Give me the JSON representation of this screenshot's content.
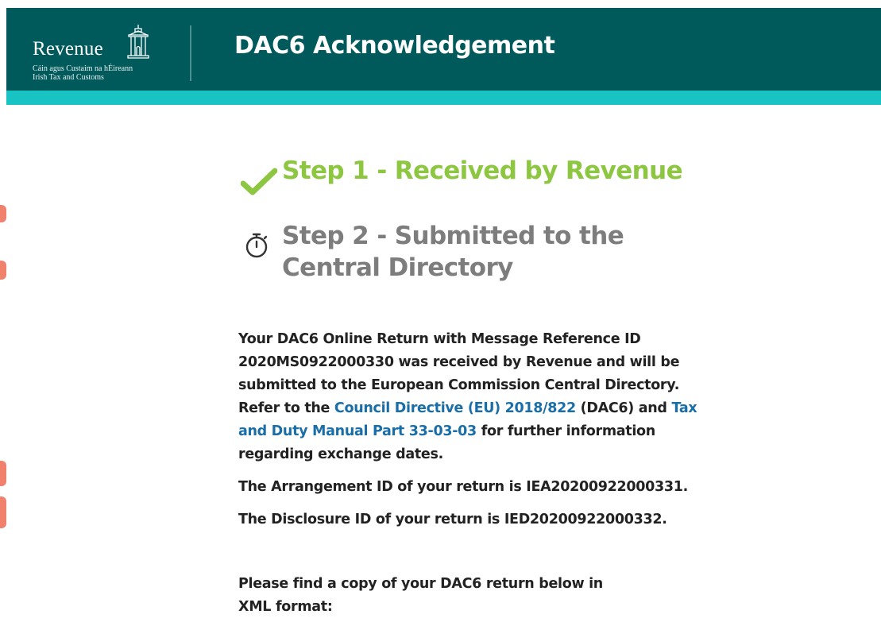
{
  "header": {
    "logo": {
      "wordmark": "Revenue",
      "sub_irish": "Cáin agus Custaim na hÉireann",
      "sub_english": "Irish Tax and Customs"
    },
    "title": "DAC6 Acknowledgement"
  },
  "steps": [
    {
      "label": "Step 1 - Received by Revenue",
      "icon": "checkmark-icon",
      "status": "complete",
      "color": "#8dc641"
    },
    {
      "label": "Step 2 - Submitted to the Central Directory",
      "icon": "stopwatch-icon",
      "status": "pending",
      "color": "#7d7d7d"
    }
  ],
  "body": {
    "para1_part1": "Your DAC6 Online Return with Message Reference ID 2020MS0922000330 was received by Revenue and will be submitted to the European Commission Central Directory. Refer to the ",
    "link_council_directive": "Council Directive (EU) 2018/822",
    "para1_part2": " (DAC6) and ",
    "link_tax_manual": "Tax and Duty Manual Part 33-03-03",
    "para1_part3": " for further information regarding exchange dates.",
    "arrangement_id_line": "The Arrangement ID of your return is IEA20200922000331.",
    "disclosure_id_line": "The Disclosure ID of your return is IED20200922000332.",
    "copy_line": "Please find a copy of your DAC6 return below in XML format:"
  },
  "colors": {
    "header_bg": "#005a5b",
    "header_stripe": "#18c3c3",
    "link": "#1a6ea8",
    "step_complete": "#8dc641",
    "step_pending": "#7d7d7d"
  }
}
